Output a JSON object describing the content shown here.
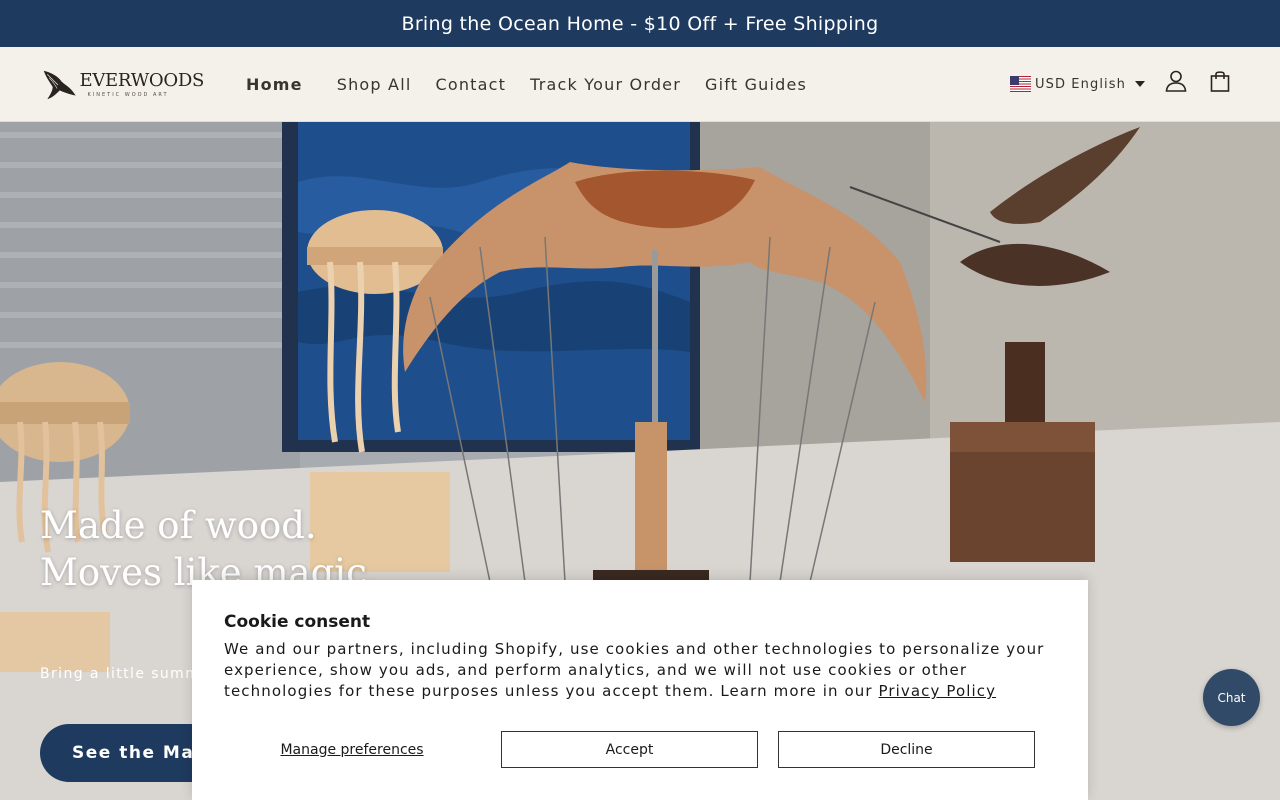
{
  "announcement": {
    "text": "Bring the Ocean Home - $10 Off + Free Shipping"
  },
  "header": {
    "logo": {
      "name": "EVERWOODS",
      "tagline": "KINETIC WOOD ART"
    },
    "nav": [
      {
        "label": "Home",
        "active": true
      },
      {
        "label": "Shop All"
      },
      {
        "label": "Contact"
      },
      {
        "label": "Track Your Order"
      },
      {
        "label": "Gift Guides"
      }
    ],
    "locale": {
      "currency": "USD",
      "language": "English",
      "label": "USD English",
      "flag_icon": "us-flag-icon"
    },
    "icons": {
      "account": "account-icon",
      "cart": "cart-icon"
    }
  },
  "hero": {
    "title_line1": "Made of wood.",
    "title_line2": "Moves like magic.",
    "subtitle": "Bring a little summe",
    "cta_label": "See the Mant"
  },
  "cookie": {
    "title": "Cookie consent",
    "body": "We and our partners, including Shopify, use cookies and other technologies to personalize your experience, show you ads, and perform analytics, and we will not use cookies or other technologies for these purposes unless you accept them. Learn more in our ",
    "privacy_link": "Privacy Policy",
    "manage_label": "Manage preferences",
    "accept_label": "Accept",
    "decline_label": "Decline"
  },
  "chat": {
    "label": "Chat"
  },
  "colors": {
    "brand_navy": "#1f3a5f",
    "header_bg": "#f4f1eb",
    "chat_bg": "#304a68"
  }
}
